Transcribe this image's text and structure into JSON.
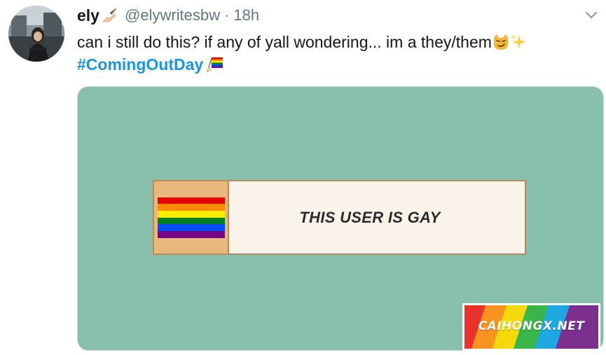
{
  "tweet": {
    "author_name": "ely",
    "name_emoji": "writing-hand-icon",
    "handle": "@elywritesbw",
    "separator": "·",
    "time": "18h",
    "text": "can i still do this? if any of yall wondering... im a they/them",
    "text_emojis": [
      "smirking-cat-icon",
      "sparkles-icon"
    ],
    "hashtag": "#ComingOutDay",
    "hashtag_emoji": "rainbow-flag-hand-icon"
  },
  "media": {
    "userbox_label": "THIS USER IS GAY",
    "flag_colors": [
      "#e40303",
      "#ff8c00",
      "#ffed00",
      "#008026",
      "#004dff",
      "#750787"
    ],
    "background_color": "#89bfad"
  },
  "watermark": {
    "text": "CAIHONGX.NET"
  }
}
